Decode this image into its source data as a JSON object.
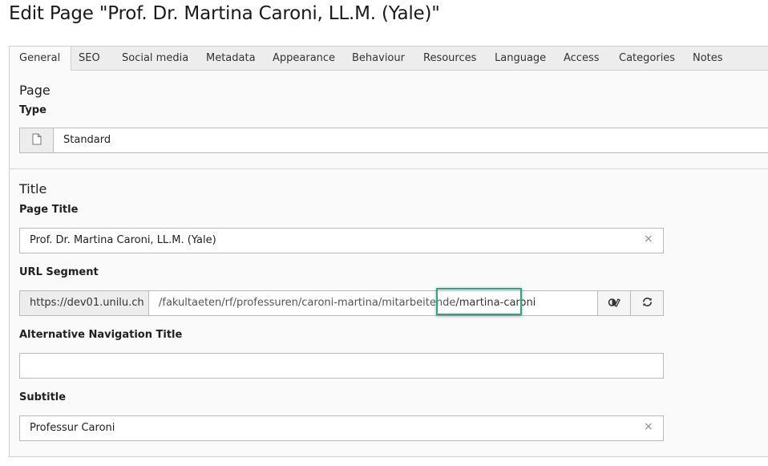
{
  "page": {
    "heading": "Edit Page \"Prof. Dr. Martina Caroni, LL.M. (Yale)\""
  },
  "tabs": [
    {
      "label": "General",
      "active": true
    },
    {
      "label": "SEO"
    },
    {
      "label": "Social media"
    },
    {
      "label": "Metadata"
    },
    {
      "label": "Appearance"
    },
    {
      "label": "Behaviour"
    },
    {
      "label": "Resources"
    },
    {
      "label": "Language"
    },
    {
      "label": "Access"
    },
    {
      "label": "Categories"
    },
    {
      "label": "Notes"
    }
  ],
  "sections": {
    "page": {
      "title": "Page",
      "type_label": "Type",
      "type_value": "Standard",
      "type_icon": "document-icon"
    },
    "title": {
      "title": "Title",
      "page_title_label": "Page Title",
      "page_title_value": "Prof. Dr. Martina Caroni, LL.M. (Yale)",
      "url_segment_label": "URL Segment",
      "url_prefix": "https://dev01.unilu.ch",
      "url_path": "/fakultaeten/rf/professuren/caroni-martina/mitarbeitende",
      "url_slug": "/martina-caroni",
      "alt_nav_label": "Alternative Navigation Title",
      "alt_nav_value": "",
      "subtitle_label": "Subtitle",
      "subtitle_value": "Professur Caroni"
    }
  },
  "icons": {
    "clear": "×",
    "toggle_edit": "toggle-edit-icon",
    "refresh": "refresh-icon"
  },
  "colors": {
    "highlight": "#2aa58a"
  }
}
